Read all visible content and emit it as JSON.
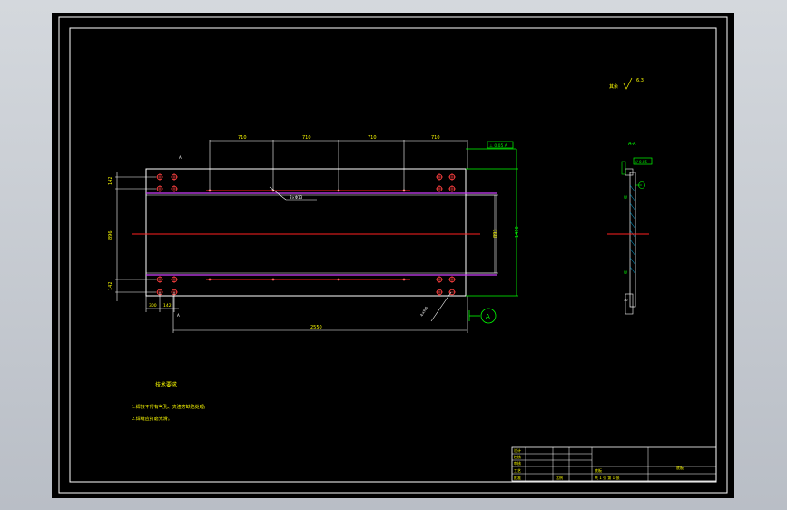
{
  "drawing": {
    "roughness_note": "其余",
    "roughness_symbol": "6.3",
    "section_title": "A-A",
    "datum_label": "A",
    "tolerance_frame_main": "⊥ 0.05 A",
    "tolerance_frame_section": "// 0.05",
    "hole_callout": "8×Φ13",
    "edge_note": "4×M6",
    "top_dims": [
      "710",
      "710",
      "710",
      "710"
    ],
    "left_dims": [
      "142",
      "896",
      "142"
    ],
    "bottom_small_dims": [
      "300",
      "142"
    ],
    "bottom_dim": "2550",
    "right_inner_dim": "893",
    "right_outer_dim": "1450",
    "view_mark": "A",
    "tech_title": "技术要求",
    "tech_items": [
      "1.焊接不得有气孔、夹渣等缺陷处理;",
      "2.焊缝应打磨光滑。"
    ]
  },
  "title_block": {
    "labels": [
      "设计",
      "校核",
      "审核",
      "工艺",
      "批准"
    ],
    "scale_label": "比例",
    "part_name": "底板",
    "sheet_note": "共 1 张  第 1 张"
  },
  "colors": {
    "background": "#000000",
    "frame": "#ffffff",
    "center": "#ff2020",
    "hidden": "#d040ff",
    "annotation": "#00ff00",
    "text": "#ffff00"
  }
}
